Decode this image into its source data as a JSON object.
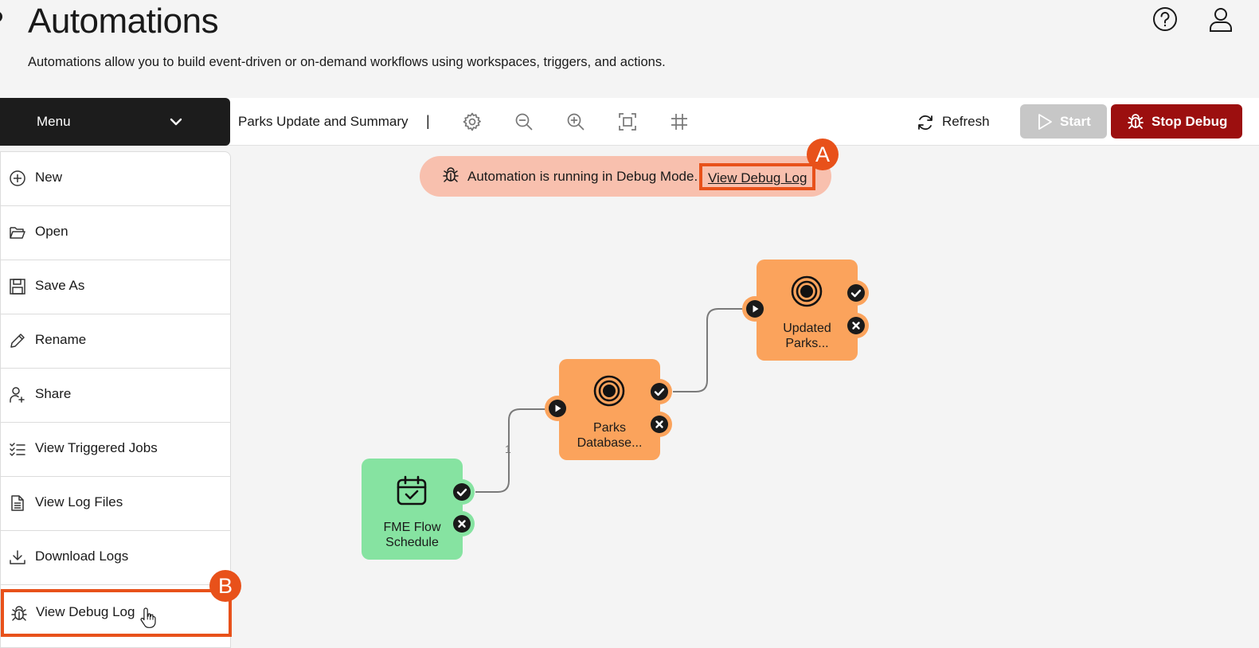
{
  "header": {
    "title": "Automations",
    "description": "Automations allow you to build event-driven or on-demand workflows using workspaces, triggers, and actions.",
    "help_icon": "help-circle-icon",
    "user_icon": "user-icon"
  },
  "toolbar": {
    "menu_label": "Menu",
    "workflow_name": "Parks Update and Summary",
    "separator": "|",
    "tools": [
      "settings-icon",
      "zoom-out-icon",
      "zoom-in-icon",
      "fit-view-icon",
      "grid-icon"
    ],
    "refresh_label": "Refresh",
    "start_label": "Start",
    "stop_debug_label": "Stop Debug"
  },
  "menu": {
    "items": [
      {
        "label": "New",
        "icon": "plus-circle-icon"
      },
      {
        "label": "Open",
        "icon": "folder-open-icon"
      },
      {
        "label": "Save As",
        "icon": "save-icon"
      },
      {
        "label": "Rename",
        "icon": "pencil-icon"
      },
      {
        "label": "Share",
        "icon": "share-user-icon"
      },
      {
        "label": "View Triggered Jobs",
        "icon": "checklist-icon"
      },
      {
        "label": "View Log Files",
        "icon": "file-text-icon"
      },
      {
        "label": "Download Logs",
        "icon": "download-icon"
      },
      {
        "label": "View Debug Log",
        "icon": "bug-icon"
      }
    ]
  },
  "banner": {
    "text": "Automation is running in Debug Mode.",
    "link": "View Debug Log"
  },
  "badges": {
    "a": "A",
    "b": "B"
  },
  "canvas": {
    "connector_label": "1",
    "nodes": [
      {
        "label_line1": "FME Flow",
        "label_line2": "Schedule",
        "type": "trigger",
        "icon": "calendar-check-icon",
        "color": "#86e3a1"
      },
      {
        "label_line1": "Parks",
        "label_line2": "Database...",
        "type": "action",
        "icon": "target-icon",
        "color": "#fba35c"
      },
      {
        "label_line1": "Updated",
        "label_line2": "Parks...",
        "type": "action",
        "icon": "target-icon",
        "color": "#fba35c"
      }
    ]
  },
  "colors": {
    "accent_highlight": "#e8511a",
    "stop_debug": "#9c0f0f",
    "banner": "#f8c0ae",
    "trigger_node": "#86e3a1",
    "action_node": "#fba35c",
    "start_disabled": "#c7c7c7"
  }
}
